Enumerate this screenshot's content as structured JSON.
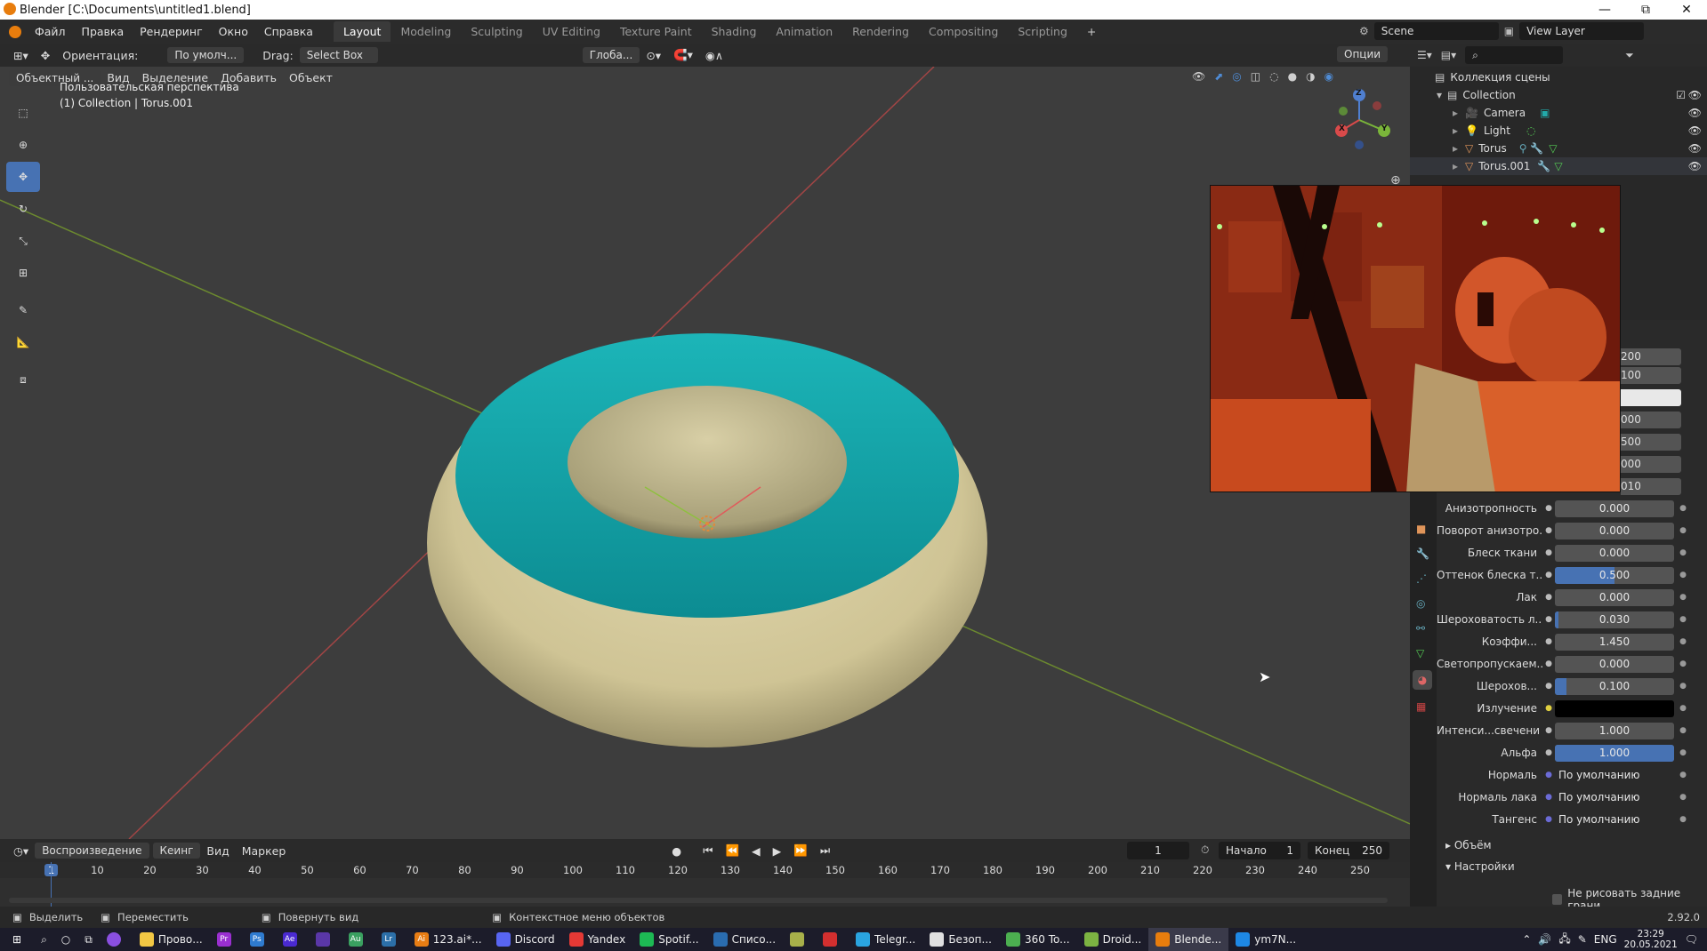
{
  "window": {
    "title": "Blender [C:\\Documents\\untitled1.blend]",
    "minimize": "—",
    "maximize": "⧉",
    "close": "✕"
  },
  "menu": [
    "Файл",
    "Правка",
    "Рендеринг",
    "Окно",
    "Справка"
  ],
  "workspaces": [
    "Layout",
    "Modeling",
    "Sculpting",
    "UV Editing",
    "Texture Paint",
    "Shading",
    "Animation",
    "Rendering",
    "Compositing",
    "Scripting"
  ],
  "workspace_add": "+",
  "scene": {
    "label": "Scene",
    "view_layer": "View Layer"
  },
  "viewport_header": {
    "orientation_label": "Ориентация:",
    "orientation_value": "По умолч...",
    "drag_label": "Drag:",
    "drag_value": "Select Box",
    "transform": "Глоба...",
    "options": "Опции"
  },
  "viewport_menu": {
    "mode": "Объектный ...",
    "items": [
      "Вид",
      "Выделение",
      "Добавить",
      "Объект"
    ]
  },
  "viewport_info": {
    "line1": "Пользовательская перспектива",
    "line2": "(1) Collection | Torus.001"
  },
  "gizmo": {
    "x": "X",
    "y": "Y",
    "z": "Z"
  },
  "outliner": {
    "root": "Коллекция сцены",
    "collection": "Collection",
    "items": [
      {
        "name": "Camera"
      },
      {
        "name": "Light"
      },
      {
        "name": "Torus"
      },
      {
        "name": "Torus.001"
      }
    ]
  },
  "properties": {
    "partial_values": [
      "200",
      "100",
      "",
      "000",
      "500",
      "000",
      "010"
    ],
    "rows": [
      {
        "label": "Анизотропность",
        "value": "0.000",
        "fill": 0
      },
      {
        "label": "Поворот анизотро...",
        "value": "0.000",
        "fill": 0
      },
      {
        "label": "Блеск ткани",
        "value": "0.000",
        "fill": 0
      },
      {
        "label": "Оттенок блеска т...",
        "value": "0.500",
        "fill": 0.5
      },
      {
        "label": "Лак",
        "value": "0.000",
        "fill": 0
      },
      {
        "label": "Шероховатость л...",
        "value": "0.030",
        "fill": 0.03
      },
      {
        "label": "Коэффи...",
        "value": "1.450",
        "fill": 0
      },
      {
        "label": "Светопропускаем...",
        "value": "0.000",
        "fill": 0
      },
      {
        "label": "Шероховатость",
        "short": "Шерохов...",
        "value": "0.100",
        "fill": 0.1
      },
      {
        "label": "Излучение",
        "value": "",
        "fill": 0
      },
      {
        "label": "Интенси...свечени",
        "value": "1.000",
        "fill": 0
      },
      {
        "label": "Альфа",
        "value": "1.000",
        "fill": 1
      },
      {
        "label": "Нормаль",
        "value": "По умолчанию",
        "fill": 0
      },
      {
        "label": "Нормаль лака",
        "value": "По умолчанию",
        "fill": 0
      },
      {
        "label": "Тангенс",
        "value": "По умолчанию",
        "fill": 0
      }
    ],
    "sections": [
      "Объём",
      "Настройки"
    ],
    "checkbox": "Не рисовать задние грани"
  },
  "timeline": {
    "menus": [
      "Воспроизведение",
      "Кеинг",
      "Вид",
      "Маркер"
    ],
    "current_frame": "1",
    "start_label": "Начало",
    "start": "1",
    "end_label": "Конец",
    "end": "250",
    "ticks": [
      "1",
      "10",
      "20",
      "30",
      "40",
      "50",
      "60",
      "70",
      "80",
      "90",
      "100",
      "110",
      "120",
      "130",
      "140",
      "150",
      "160",
      "170",
      "180",
      "190",
      "200",
      "210",
      "220",
      "230",
      "240",
      "250"
    ]
  },
  "status": {
    "select": "Выделить",
    "move": "Переместить",
    "rotate": "Повернуть вид",
    "context": "Контекстное меню объектов",
    "version": "2.92.0"
  },
  "taskbar": {
    "apps": [
      {
        "label": "Прово...",
        "color": "#f2c744"
      },
      {
        "label": "",
        "color": "#9a2fd0"
      },
      {
        "label": "",
        "color": "#2f7bd0"
      },
      {
        "label": "",
        "color": "#4a2ad0"
      },
      {
        "label": "",
        "color": "#5a37a8"
      },
      {
        "label": "",
        "color": "#3aa060"
      },
      {
        "label": "",
        "color": "#2c6fa8"
      },
      {
        "label": "123.ai*...",
        "color": "#e87d14"
      },
      {
        "label": "Discord",
        "color": "#5865f2"
      },
      {
        "label": "Yandex",
        "color": "#e53935"
      },
      {
        "label": "Spotif...",
        "color": "#1db954"
      },
      {
        "label": "Списо...",
        "color": "#2a6cb0"
      },
      {
        "label": "",
        "color": "#a8b04a"
      },
      {
        "label": "",
        "color": "#d32f2f"
      },
      {
        "label": "Telegr...",
        "color": "#2aa4e0"
      },
      {
        "label": "Безоп...",
        "color": "#e0e0e0"
      },
      {
        "label": "360 To...",
        "color": "#4caf50"
      },
      {
        "label": "Droid...",
        "color": "#7cb342"
      },
      {
        "label": "Blende...",
        "color": "#e87d0d"
      },
      {
        "label": "ym7N...",
        "color": "#1e88e5"
      }
    ],
    "app_codes": [
      "Pr",
      "Ps",
      "Ae",
      "",
      "Au",
      "Lr",
      "Ai"
    ],
    "lang": "ENG",
    "time": "23:29",
    "date": "20.05.2021"
  },
  "colors": {
    "accent": "#4772b3",
    "torus_cyan": "#14a5aa",
    "torus_beige": "#d6cda0"
  }
}
